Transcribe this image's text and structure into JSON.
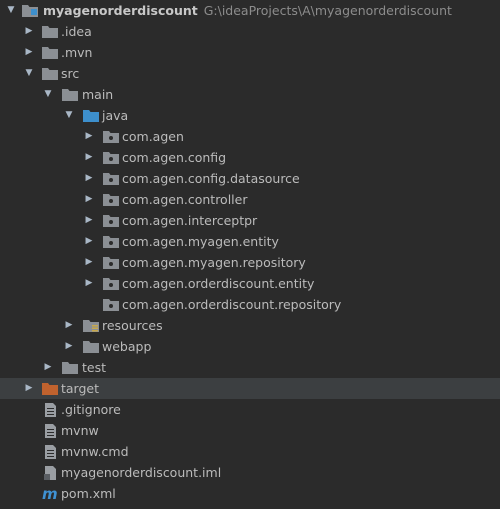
{
  "project": {
    "name": "myagenorderdiscount",
    "path": "G:\\ideaProjects\\A\\myagenorderdiscount"
  },
  "colors": {
    "background": "#2b2b2b",
    "folder": "#8b8f94",
    "source_folder": "#3d8fcc",
    "excluded_folder": "#c0622e",
    "selected_row": "#3c3f41",
    "maven_icon": "#3f91d2"
  },
  "tree": {
    "idea": ".idea",
    "mvn": ".mvn",
    "src": "src",
    "main": "main",
    "java": "java",
    "pkg1": "com.agen",
    "pkg2": "com.agen.config",
    "pkg3": "com.agen.config.datasource",
    "pkg4": "com.agen.controller",
    "pkg5": "com.agen.interceptpr",
    "pkg6": "com.agen.myagen.entity",
    "pkg7": "com.agen.myagen.repository",
    "pkg8": "com.agen.orderdiscount.entity",
    "pkg9": "com.agen.orderdiscount.repository",
    "resources": "resources",
    "webapp": "webapp",
    "test": "test",
    "target": "target",
    "gitignore": ".gitignore",
    "mvnw": "mvnw",
    "mvnw_cmd": "mvnw.cmd",
    "iml": "myagenorderdiscount.iml",
    "pom": "pom.xml"
  }
}
